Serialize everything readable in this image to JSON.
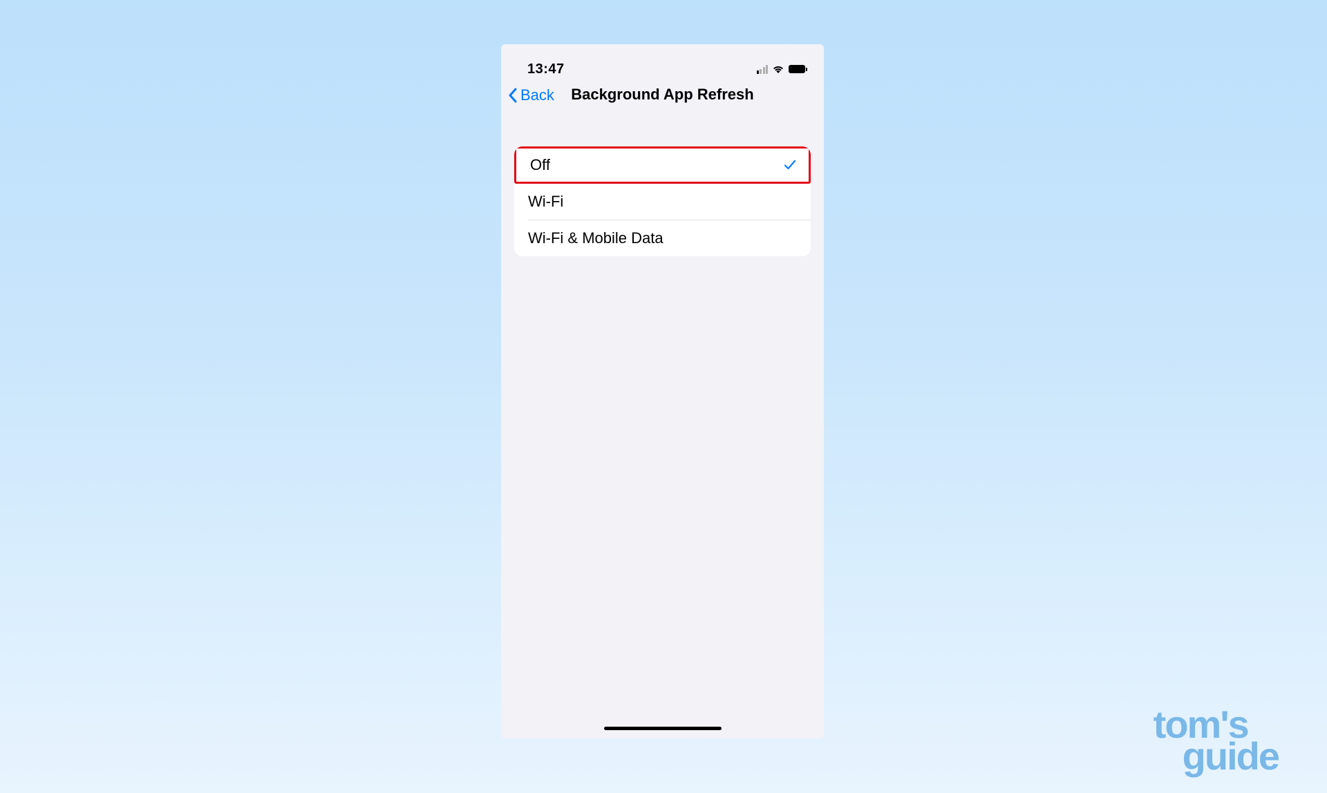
{
  "status": {
    "time": "13:47"
  },
  "nav": {
    "back_label": "Back",
    "title": "Background App Refresh"
  },
  "options": [
    {
      "label": "Off",
      "selected": true,
      "highlighted": true
    },
    {
      "label": "Wi-Fi",
      "selected": false,
      "highlighted": false
    },
    {
      "label": "Wi-Fi & Mobile Data",
      "selected": false,
      "highlighted": false
    }
  ],
  "watermark": {
    "line1": "tom's",
    "line2": "guide"
  },
  "colors": {
    "ios_blue": "#007aff",
    "highlight_red": "#e30613",
    "watermark_blue": "#7ab8e8"
  }
}
